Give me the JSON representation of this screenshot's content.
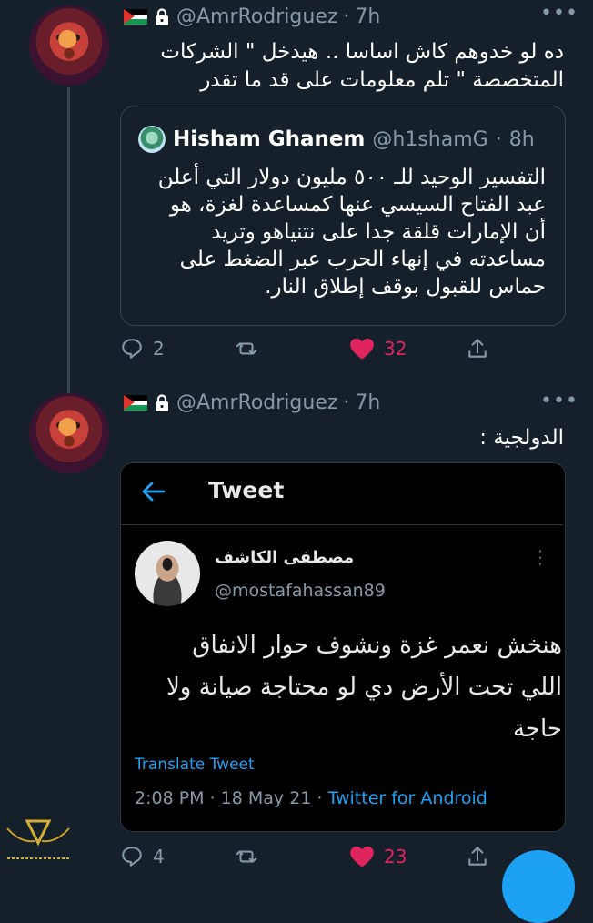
{
  "tweets": [
    {
      "handle": "@AmrRodriguez",
      "time": "7h",
      "text_line1": "ده لو خدوهم كاش اساسا .. هيدخل \" الشركات",
      "text_line2": "المتخصصة \" تلم معلومات على قد ما تقدر",
      "quote": {
        "name": "Hisham Ghanem",
        "handle": "@h1shamG",
        "time": "8h",
        "line1": "التفسير الوحيد للـ ٥٠٠ مليون دولار التي أعلن",
        "line2": "عبد الفتاح السيسي عنها كمساعدة لغزة، هو",
        "line3": "أن الإمارات قلقة جدا على نتنياهو وتريد",
        "line4": "مساعدته في إنهاء الحرب عبر الضغط على",
        "line5": "حماس للقبول بوقف إطلاق النار."
      },
      "replies": "2",
      "likes": "32"
    },
    {
      "handle": "@AmrRodriguez",
      "time": "7h",
      "text": "الدولجية :",
      "screenshot": {
        "title": "Tweet",
        "name": "مصطفى الكاشف",
        "handle": "@mostafahassan89",
        "line1": "هنخش نعمر غزة ونشوف حوار الانفاق",
        "line2": "اللي تحت الأرض دي لو محتاجة صيانة ولا",
        "line3": "حاجة",
        "translate": "Translate Tweet",
        "meta": "2:08 PM · 18 May 21 · ",
        "source": "Twitter for Android"
      },
      "replies": "4",
      "likes": "23"
    }
  ],
  "colors": {
    "background": "#15202b",
    "muted": "#8899a6",
    "like": "#e0245e",
    "link": "#1da1f2"
  },
  "icons": [
    "palestine-flag-icon",
    "lock-icon",
    "more-icon",
    "reply-icon",
    "retweet-icon",
    "heart-icon",
    "share-icon",
    "back-arrow-icon"
  ]
}
